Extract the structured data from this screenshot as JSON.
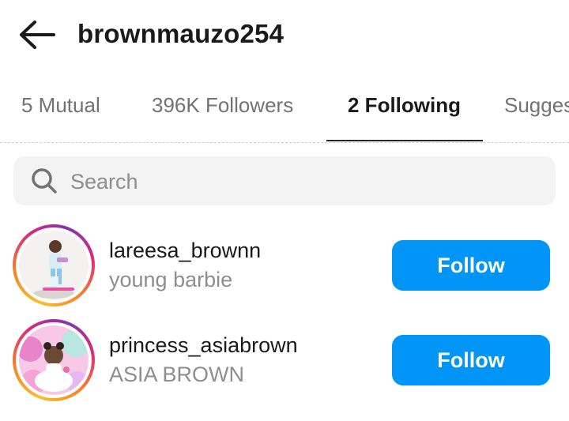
{
  "header": {
    "title": "brownmauzo254",
    "back_icon": "arrow-left-icon"
  },
  "tabs": [
    {
      "label": "5 Mutual",
      "active": false
    },
    {
      "label": "396K Followers",
      "active": false
    },
    {
      "label": "2 Following",
      "active": true
    },
    {
      "label": "Sugges",
      "active": false
    }
  ],
  "search": {
    "placeholder": "Search",
    "value": "",
    "icon": "search-icon"
  },
  "users": [
    {
      "username": "lareesa_brownn",
      "name": "young barbie",
      "button_label": "Follow"
    },
    {
      "username": "princess_asiabrown",
      "name": "ASIA BROWN",
      "button_label": "Follow"
    }
  ],
  "colors": {
    "accent": "#0095f6",
    "text_primary": "#1a1a1a",
    "text_secondary": "#8e8e8e",
    "search_bg": "#f3f3f3"
  }
}
